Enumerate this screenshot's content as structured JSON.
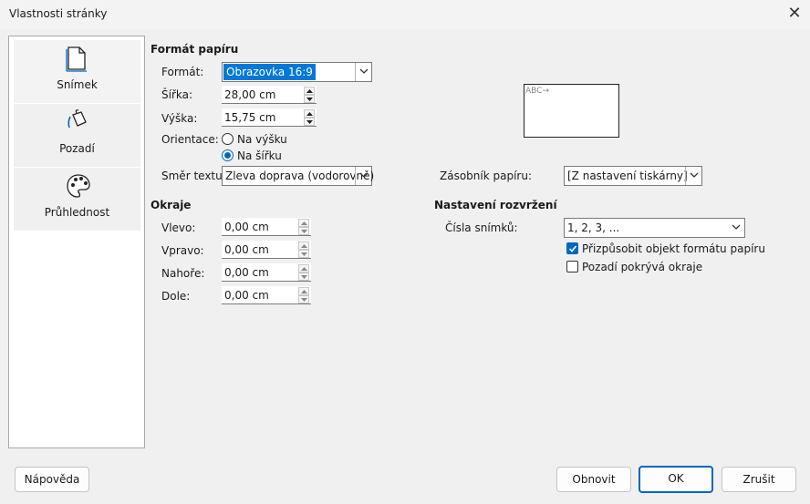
{
  "window": {
    "title": "Vlastnosti stránky"
  },
  "sidebar": {
    "items": [
      {
        "label": "Snímek",
        "icon": "page-icon"
      },
      {
        "label": "Pozadí",
        "icon": "paint-bucket-icon"
      },
      {
        "label": "Průhlednost",
        "icon": "palette-icon"
      }
    ]
  },
  "paper_format": {
    "heading": "Formát papíru",
    "format_label": "Formát:",
    "format_value": "Obrazovka 16:9",
    "width_label": "Šířka:",
    "width_value": "28,00 cm",
    "height_label": "Výška:",
    "height_value": "15,75 cm",
    "orientation_label": "Orientace:",
    "portrait_label": "Na výšku",
    "landscape_label": "Na šířku",
    "orientation_selected": "landscape",
    "text_direction_label": "Směr textu:",
    "text_direction_value": "Zleva doprava (vodorovně)",
    "preview_text": "ABC→",
    "paper_tray_label": "Zásobník papíru:",
    "paper_tray_value": "[Z nastavení tiskárny]"
  },
  "margins": {
    "heading": "Okraje",
    "left_label": "Vlevo:",
    "left_value": "0,00 cm",
    "right_label": "Vpravo:",
    "right_value": "0,00 cm",
    "top_label": "Nahoře:",
    "top_value": "0,00 cm",
    "bottom_label": "Dole:",
    "bottom_value": "0,00 cm"
  },
  "layout": {
    "heading": "Nastavení rozvržení",
    "slide_numbers_label": "Čísla snímků:",
    "slide_numbers_value": "1, 2, 3, ...",
    "fit_object_label": "Přizpůsobit objekt formátu papíru",
    "fit_object_checked": true,
    "bg_covers_margins_label": "Pozadí pokrývá okraje",
    "bg_covers_margins_checked": false
  },
  "buttons": {
    "help": "Nápověda",
    "reset": "Obnovit",
    "ok": "OK",
    "cancel": "Zrušit"
  },
  "colors": {
    "accent": "#0067c0",
    "selection": "#0078d7"
  }
}
